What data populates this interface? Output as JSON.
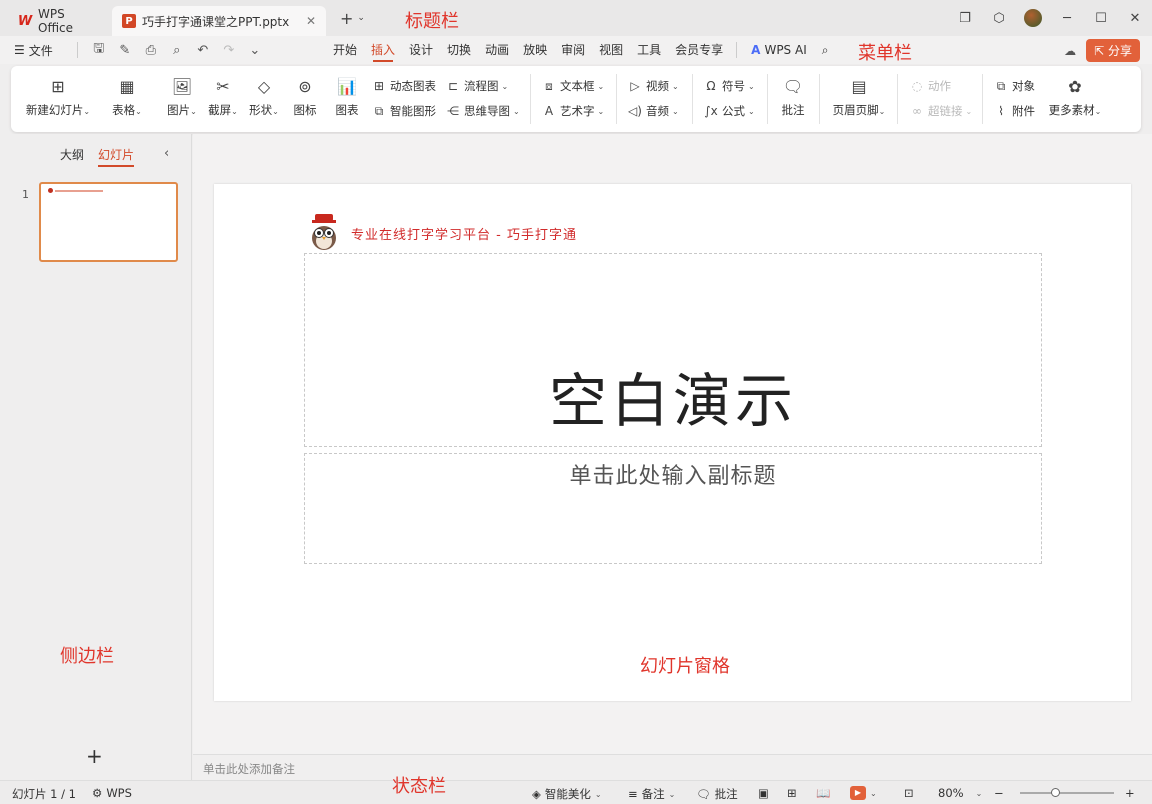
{
  "titlebar": {
    "home_tab": "WPS Office",
    "doc_tab": "巧手打字通课堂之PPT.pptx",
    "annotation": "标题栏"
  },
  "menubar": {
    "file": "文件",
    "items": [
      "开始",
      "插入",
      "设计",
      "切换",
      "动画",
      "放映",
      "审阅",
      "视图",
      "工具",
      "会员专享"
    ],
    "active": "插入",
    "wps_ai": "WPS AI",
    "share": "分享",
    "annotation": "菜单栏"
  },
  "ribbon": {
    "new_slide": "新建幻灯片",
    "table": "表格",
    "picture": "图片",
    "screenshot": "截屏",
    "shape": "形状",
    "icon": "图标",
    "chart": "图表",
    "dynamic_chart": "动态图表",
    "smart_art": "智能图形",
    "flowchart": "流程图",
    "mindmap": "思维导图",
    "textbox": "文本框",
    "wordart": "艺术字",
    "video": "视频",
    "audio": "音频",
    "symbol": "符号",
    "formula": "公式",
    "comment": "批注",
    "header_footer": "页眉页脚",
    "action": "动作",
    "hyperlink": "超链接",
    "object": "对象",
    "attachment": "附件",
    "more_material": "更多素材"
  },
  "sidebar": {
    "tab_outline": "大纲",
    "tab_slides": "幻灯片",
    "slide_number": "1",
    "annotation": "侧边栏"
  },
  "slide": {
    "header_text": "专业在线打字学习平台 - 巧手打字通",
    "title": "空白演示",
    "subtitle_placeholder": "单击此处输入副标题",
    "annotation": "幻灯片窗格"
  },
  "notes": {
    "placeholder": "单击此处添加备注"
  },
  "statusbar": {
    "slide_count": "幻灯片 1 / 1",
    "wps": "WPS",
    "smart_beautify": "智能美化",
    "notes": "备注",
    "comments": "批注",
    "zoom": "80%",
    "annotation": "状态栏"
  },
  "colors": {
    "accent": "#d24a2a",
    "annotation_red": "#e0352b",
    "share_button": "#e2613a"
  }
}
